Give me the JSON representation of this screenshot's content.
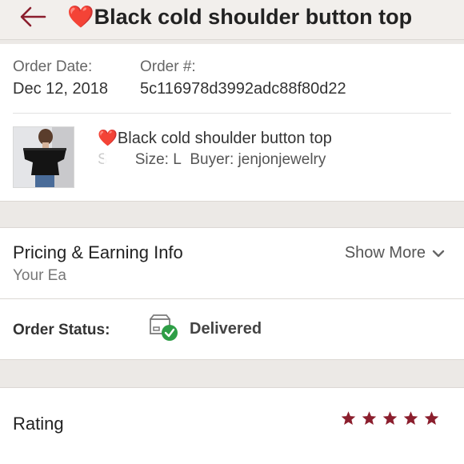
{
  "header": {
    "back_icon": "back-arrow-icon",
    "heart": "❤️",
    "title": "Black cold shoulder button top"
  },
  "order": {
    "date_label": "Order Date:",
    "date_value": "Dec 12, 2018",
    "number_label": "Order #:",
    "number_value": "5c116978d3992adc88f80d22"
  },
  "item": {
    "heart": "❤️",
    "title": "Black cold shoulder button top",
    "size_text": "Size: L",
    "buyer_text": "Buyer: jenjonjewelry",
    "obscured_prefix": "S"
  },
  "pricing": {
    "title": "Pricing & Earning Info",
    "subtitle": "Your Ea",
    "show_more": "Show More"
  },
  "status": {
    "label": "Order Status:",
    "value": "Delivered",
    "icon": "delivered-box-icon"
  },
  "rating": {
    "label": "Rating",
    "stars": 5,
    "star_color": "#8b1e2d"
  },
  "colors": {
    "accent": "#8b1e2d",
    "heart": "#d9151e",
    "check": "#2e9e46",
    "background": "#ece9e6"
  }
}
